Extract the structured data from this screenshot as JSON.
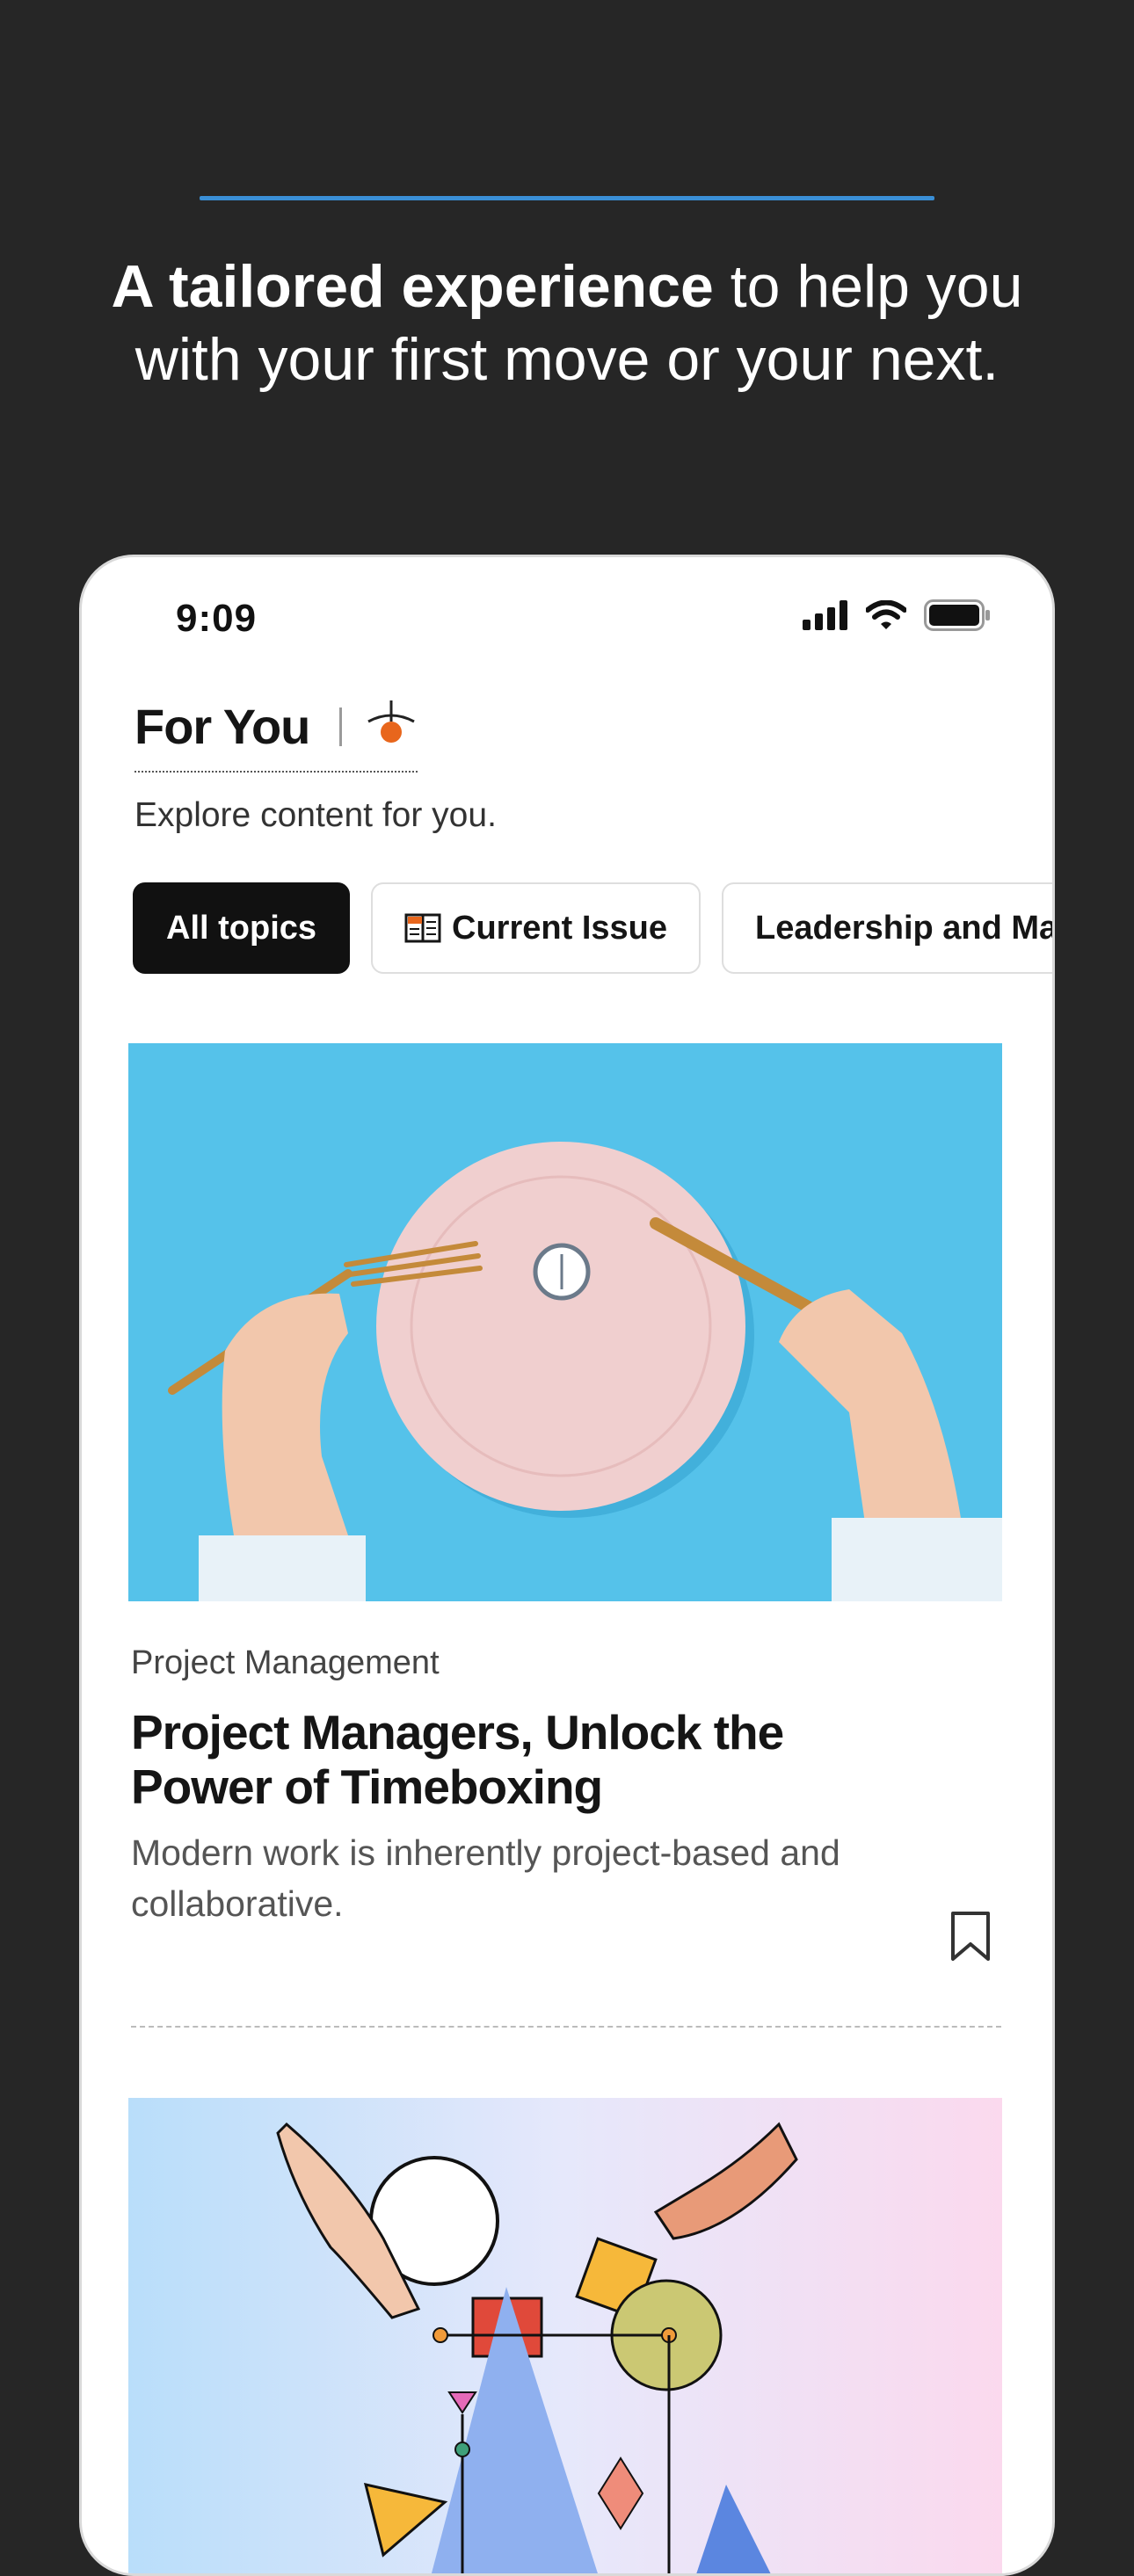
{
  "promo": {
    "headline_bold": "A tailored experience",
    "headline_rest_line1": " to help you",
    "headline_line2": "with your first move or your next."
  },
  "status_bar": {
    "time": "9:09",
    "icons": [
      "cellular-signal-icon",
      "wifi-icon",
      "battery-icon"
    ]
  },
  "header": {
    "title": "For You",
    "subtitle": "Explore content for you."
  },
  "chips": [
    {
      "label": "All topics",
      "active": true
    },
    {
      "label": "Current Issue",
      "icon": "magazine-icon",
      "active": false
    },
    {
      "label": "Leadership and Man",
      "active": false
    }
  ],
  "articles": [
    {
      "category": "Project Management",
      "title": "Project Managers, Unlock the Power of Timeboxing",
      "description": "Modern work is inherently project-based and collaborative.",
      "image": "plate-with-clock-and-cutlery-illustration",
      "bookmark_icon": "bookmark-icon"
    },
    {
      "image": "hands-with-geometric-shapes-illustration"
    }
  ],
  "colors": {
    "background": "#262626",
    "accent_line": "#3a8fd6",
    "chip_active": "#111111",
    "hero_blue": "#55c2ea",
    "profile_dot": "#e8661c"
  }
}
